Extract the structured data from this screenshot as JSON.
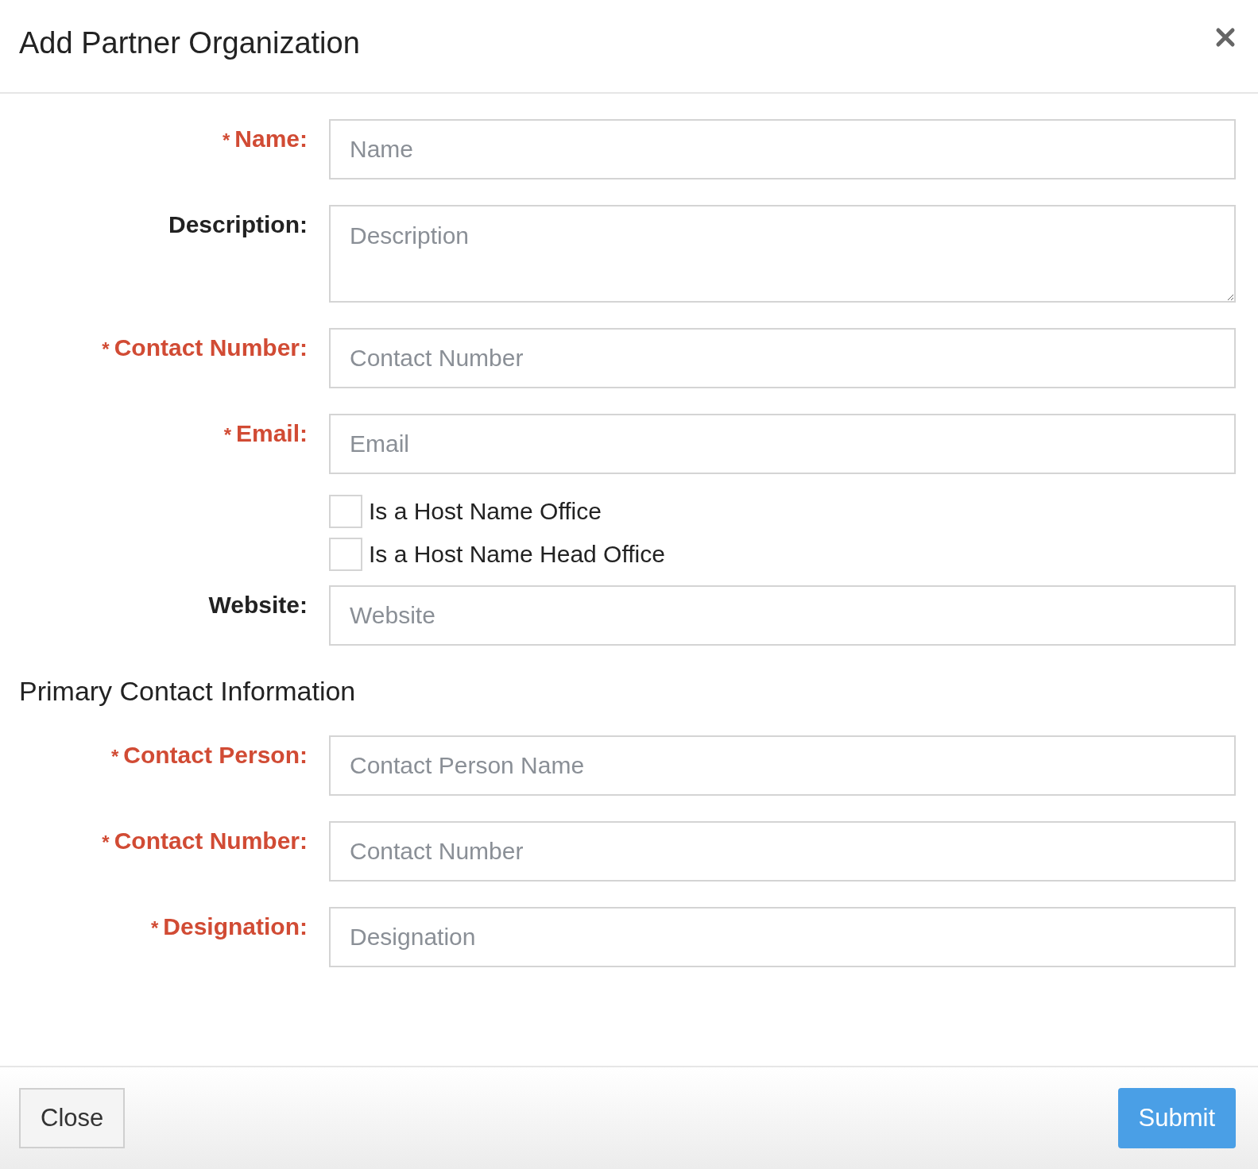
{
  "dialog": {
    "title": "Add Partner Organization"
  },
  "fields": [
    {
      "kind": "input",
      "required": true,
      "mark": "*",
      "label": "Name:",
      "placeholder": "Name"
    },
    {
      "kind": "textarea",
      "required": false,
      "label": "Description:",
      "placeholder": "Description"
    },
    {
      "kind": "input",
      "required": true,
      "mark": "*",
      "label": "Contact Number:",
      "placeholder": "Contact Number"
    },
    {
      "kind": "input",
      "required": true,
      "mark": "*",
      "label": "Email:",
      "placeholder": "Email"
    },
    {
      "kind": "checkbox",
      "checked": false,
      "label": "Is a Host Name Office"
    },
    {
      "kind": "checkbox",
      "checked": false,
      "label": "Is a Host Name Head Office"
    },
    {
      "kind": "input",
      "required": false,
      "label": "Website:",
      "placeholder": "Website"
    }
  ],
  "primary_contact": {
    "heading": "Primary Contact Information",
    "fields": [
      {
        "kind": "input",
        "required": true,
        "mark": "*",
        "label": "Contact Person:",
        "placeholder": "Contact Person Name"
      },
      {
        "kind": "input",
        "required": true,
        "mark": "*",
        "label": "Contact Number:",
        "placeholder": "Contact Number"
      },
      {
        "kind": "input",
        "required": true,
        "mark": "*",
        "label": "Designation:",
        "placeholder": "Designation"
      }
    ]
  },
  "footer": {
    "close_button": "Close",
    "submit_button": "Submit"
  }
}
